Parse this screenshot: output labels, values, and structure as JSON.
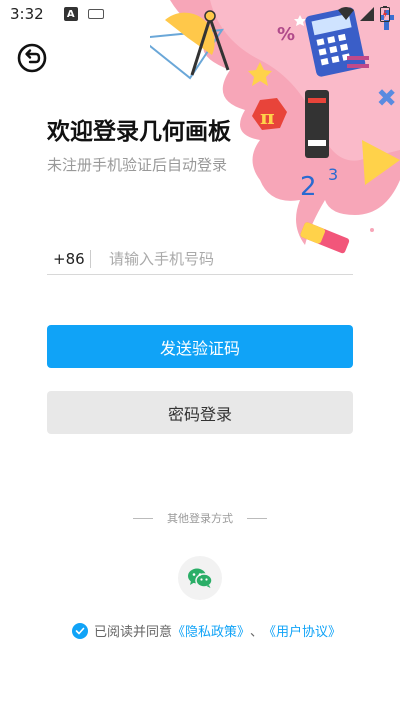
{
  "status": {
    "time": "3:32",
    "notif_a": "A"
  },
  "header": {
    "title": "欢迎登录几何画板",
    "subtitle": "未注册手机验证后自动登录"
  },
  "phone": {
    "country_code": "+86",
    "placeholder": "请输入手机号码",
    "value": ""
  },
  "buttons": {
    "send_code": "发送验证码",
    "password_login": "密码登录"
  },
  "other_login": {
    "label": "其他登录方式"
  },
  "agreement": {
    "prefix": "已阅读并同意",
    "privacy": "《隐私政策》",
    "separator": "、",
    "terms": "《用户协议》",
    "checked": true
  },
  "colors": {
    "accent": "#10a3f7",
    "secondary_bg": "#e8e8e8",
    "decor_pink": "#f7a6b8",
    "wechat_green": "#2aae67"
  },
  "icons": [
    "back-icon",
    "wechat-icon",
    "check-icon",
    "wifi-icon",
    "battery-icon",
    "keyboard-icon"
  ]
}
